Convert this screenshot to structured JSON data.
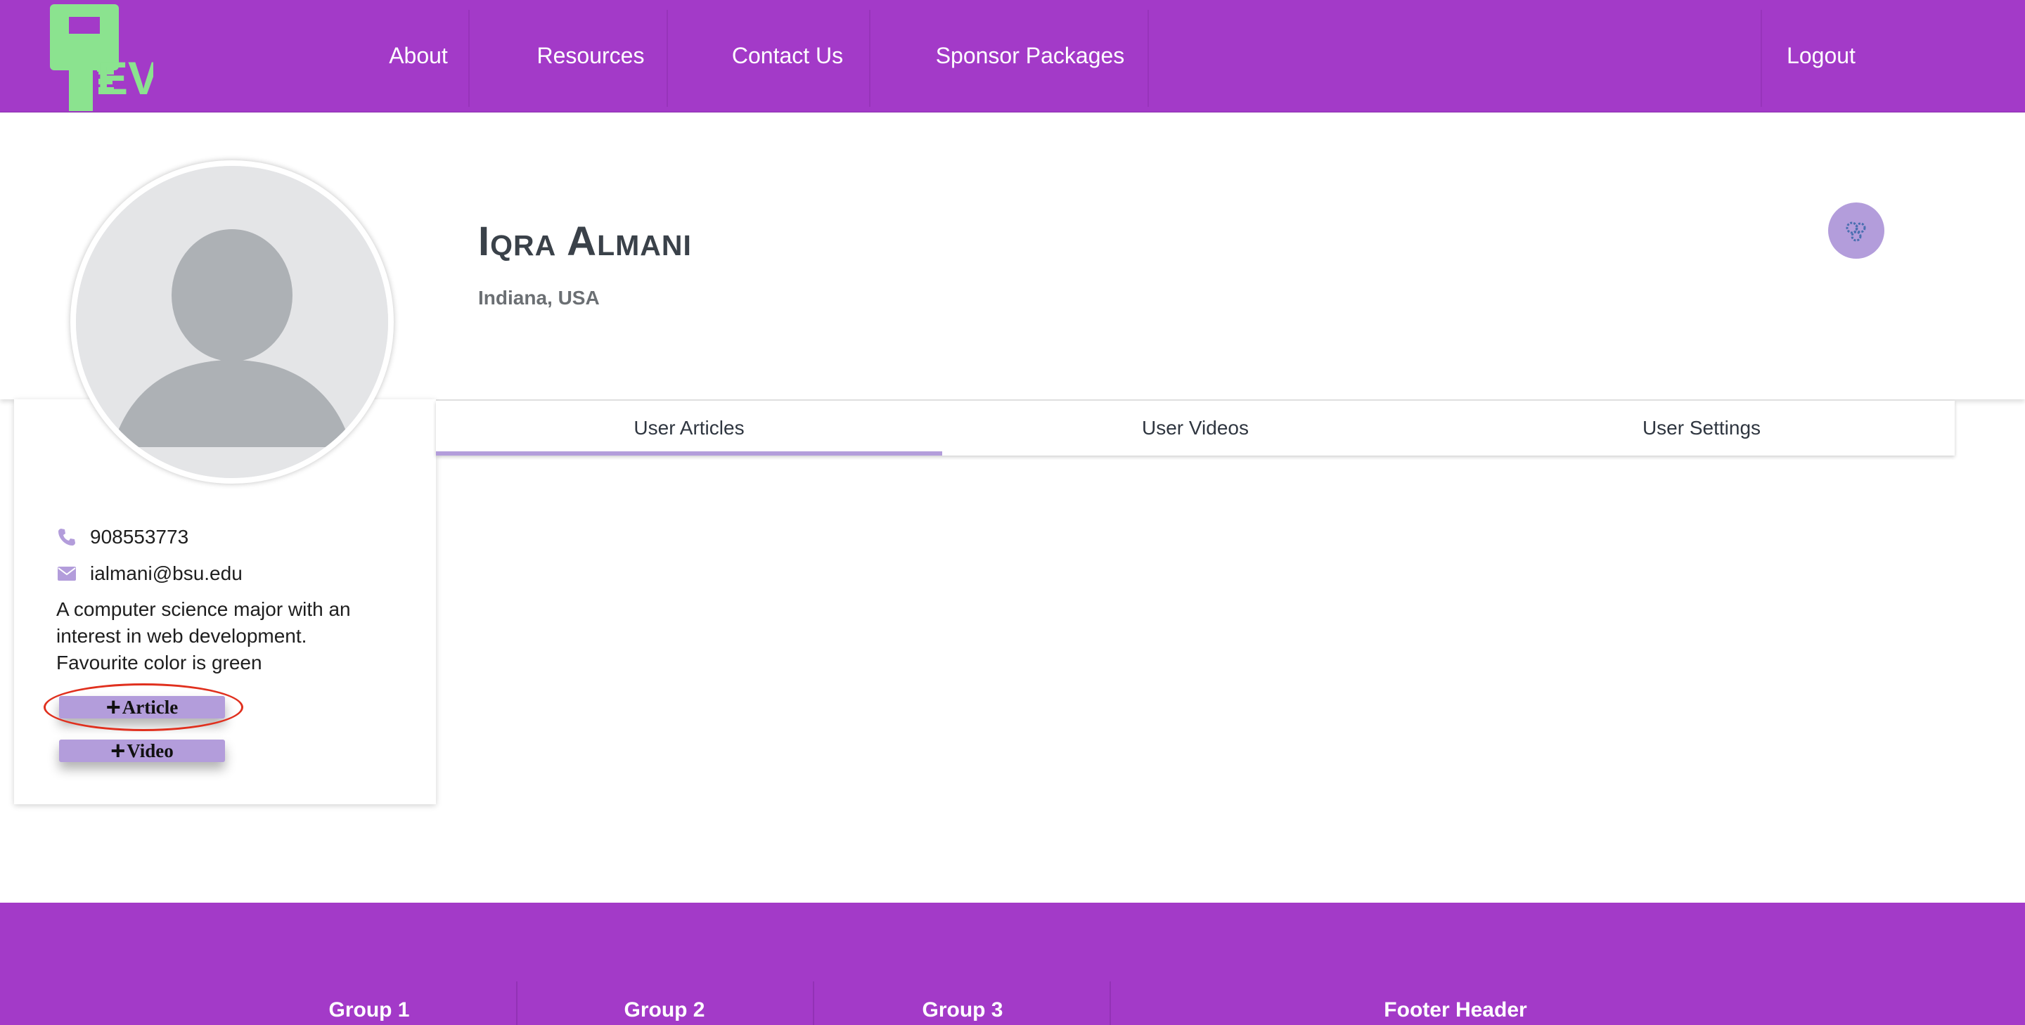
{
  "colors": {
    "nav_bg": "#a33ac8",
    "accent": "#b39ddb",
    "logo_green": "#8be38f"
  },
  "nav": {
    "logo_text": "EVE",
    "items": [
      {
        "label": "About"
      },
      {
        "label": "Resources"
      },
      {
        "label": "Contact Us"
      },
      {
        "label": "Sponsor Packages"
      }
    ],
    "logout_label": "Logout"
  },
  "profile": {
    "name": "Iqra Almani",
    "location": "Indiana, USA",
    "phone": "908553773",
    "email": "ialmani@bsu.edu",
    "bio": "A computer science major with an interest in web development. Favourite color is green",
    "settings_icon": "gear-cluster-icon",
    "avatar_icon": "default-user-avatar"
  },
  "actions": {
    "add_article_label": "Article",
    "add_video_label": "Video"
  },
  "tabs": [
    {
      "label": "User Articles",
      "active": true
    },
    {
      "label": "User Videos",
      "active": false
    },
    {
      "label": "User Settings",
      "active": false
    }
  ],
  "footer": {
    "columns": [
      {
        "label": "Group 1"
      },
      {
        "label": "Group 2"
      },
      {
        "label": "Group 3"
      },
      {
        "label": "Footer Header"
      }
    ]
  }
}
